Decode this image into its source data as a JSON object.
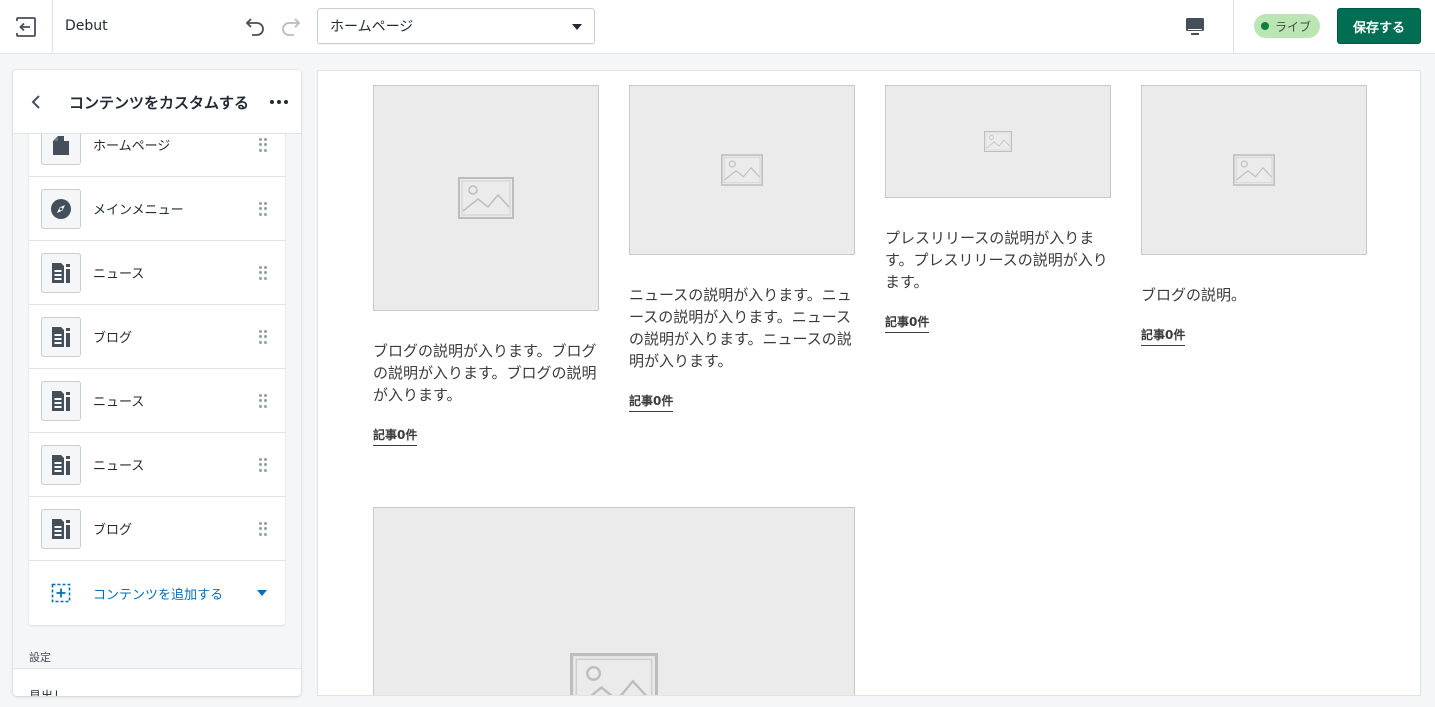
{
  "topbar": {
    "theme_name": "Debut",
    "page_selected": "ホームページ",
    "live_label": "ライブ",
    "save_label": "保存する"
  },
  "sidebar": {
    "title": "コンテンツをカスタムする",
    "sections": [
      {
        "label": "ホームページ",
        "icon": "bag-icon"
      },
      {
        "label": "メインメニュー",
        "icon": "compass-icon"
      },
      {
        "label": "ニュース",
        "icon": "blog-icon"
      },
      {
        "label": "ブログ",
        "icon": "blog-icon"
      },
      {
        "label": "ニュース",
        "icon": "blog-icon"
      },
      {
        "label": "ニュース",
        "icon": "blog-icon"
      },
      {
        "label": "ブログ",
        "icon": "blog-icon"
      }
    ],
    "add_content_label": "コンテンツを追加する",
    "settings_label": "設定",
    "settings_field_label": "見出し"
  },
  "preview": {
    "cards": [
      {
        "description": "ブログの説明が入ります。ブログの説明が入ります。ブログの説明が入ります。",
        "link": "記事0件"
      },
      {
        "description": "ニュースの説明が入ります。ニュースの説明が入ります。ニュースの説明が入ります。ニュースの説明が入ります。",
        "link": "記事0件"
      },
      {
        "description": "プレスリリースの説明が入ります。プレスリリースの説明が入ります。",
        "link": "記事0件"
      },
      {
        "description": "ブログの説明。",
        "link": "記事0件"
      }
    ]
  },
  "colors": {
    "primary": "#006e52",
    "live_badge": "#bbe5b3",
    "link_blue": "#006fbb"
  }
}
